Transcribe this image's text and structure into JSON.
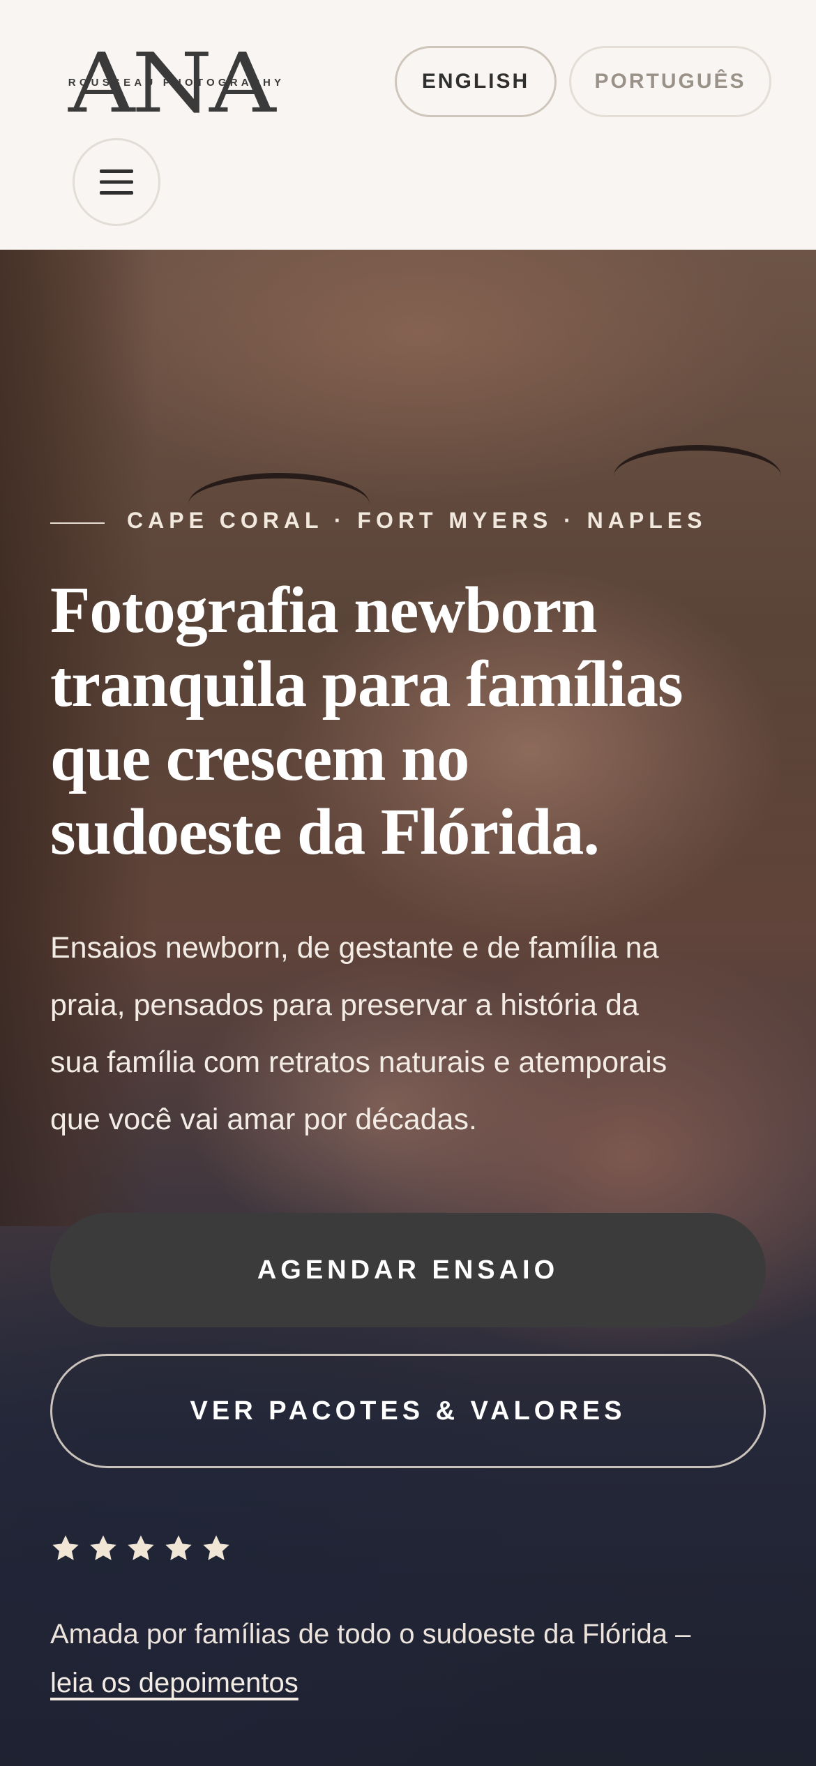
{
  "header": {
    "logo": {
      "letters": "ANA",
      "tagline": "ROUSSEAU PHOTOGRAPHY"
    },
    "languages": [
      {
        "label": "ENGLISH",
        "active": true
      },
      {
        "label": "PORTUGUÊS",
        "active": false
      }
    ],
    "menu_icon": "hamburger-icon"
  },
  "hero": {
    "eyebrow": "CAPE CORAL · FORT MYERS · NAPLES",
    "headline_lines": [
      "Fotografia newborn",
      "tranquila para famílias",
      "que crescem no",
      "sudoeste da Flórida."
    ],
    "lede_lines": [
      "Ensaios newborn, de gestante e de família na",
      "praia, pensados para preservar a história da",
      "sua família com retratos naturais e atemporais",
      "que você vai amar por décadas."
    ],
    "primary_cta": "AGENDAR ENSAIO",
    "secondary_cta": "VER PACOTES & VALORES",
    "rating": 5,
    "star_icon": "star-icon",
    "reviews_text": "Amada por famílias de todo o sudoeste da Flórida –",
    "reviews_link": "leia os depoimentos"
  },
  "colors": {
    "background": "#f8f5f2",
    "primary_button": "#3b3b3b",
    "star": "#f1e6d6",
    "text_dark": "#2f2f2f"
  }
}
